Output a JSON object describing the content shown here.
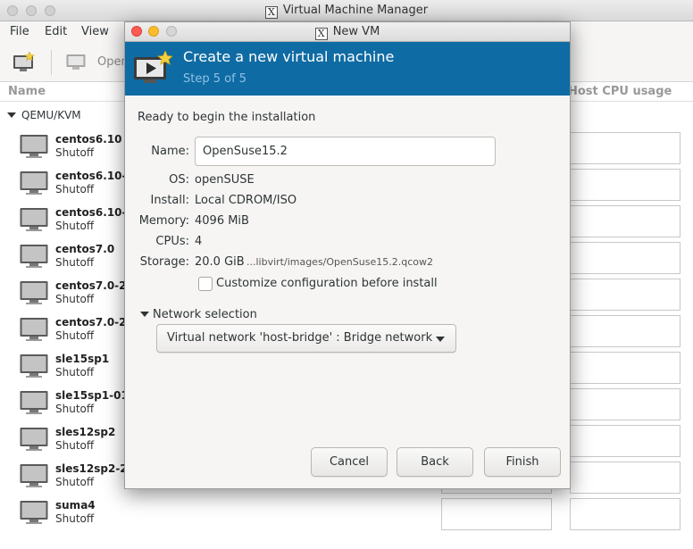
{
  "main_window": {
    "title": "Virtual Machine Manager",
    "menu": [
      "File",
      "Edit",
      "View"
    ],
    "toolbar": {
      "open_label": "Open"
    },
    "columns": {
      "name": "Name",
      "host_cpu": "Host CPU usage"
    },
    "connection": "QEMU/KVM",
    "vms": [
      {
        "name": "centos6.10",
        "state": "Shutoff"
      },
      {
        "name": "centos6.10-",
        "state": "Shutoff"
      },
      {
        "name": "centos6.10-",
        "state": "Shutoff"
      },
      {
        "name": "centos7.0",
        "state": "Shutoff"
      },
      {
        "name": "centos7.0-2",
        "state": "Shutoff"
      },
      {
        "name": "centos7.0-2",
        "state": "Shutoff"
      },
      {
        "name": "sle15sp1",
        "state": "Shutoff"
      },
      {
        "name": "sle15sp1-01",
        "state": "Shutoff"
      },
      {
        "name": "sles12sp2",
        "state": "Shutoff"
      },
      {
        "name": "sles12sp2-2",
        "state": "Shutoff"
      },
      {
        "name": "suma4",
        "state": "Shutoff"
      }
    ]
  },
  "dialog": {
    "title": "New VM",
    "banner_title": "Create a new virtual machine",
    "banner_step": "Step 5 of 5",
    "ready_text": "Ready to begin the installation",
    "name_label": "Name:",
    "name_value": "OpenSuse15.2",
    "os_label": "OS:",
    "os_value": "openSUSE",
    "install_label": "Install:",
    "install_value": "Local CDROM/ISO",
    "memory_label": "Memory:",
    "memory_value": "4096 MiB",
    "cpus_label": "CPUs:",
    "cpus_value": "4",
    "storage_label": "Storage:",
    "storage_value": "20.0 GiB",
    "storage_path": "...libvirt/images/OpenSuse15.2.qcow2",
    "customize_label": "Customize configuration before install",
    "customize_checked": false,
    "network_section_label": "Network selection",
    "network_value": "Virtual network 'host-bridge' : Bridge network",
    "buttons": {
      "cancel": "Cancel",
      "back": "Back",
      "finish": "Finish"
    }
  },
  "colors": {
    "banner": "#0f6ba3",
    "banner_step_text": "#8fc1e6",
    "close": "#fd5c55",
    "minimize": "#fdbc2e"
  }
}
